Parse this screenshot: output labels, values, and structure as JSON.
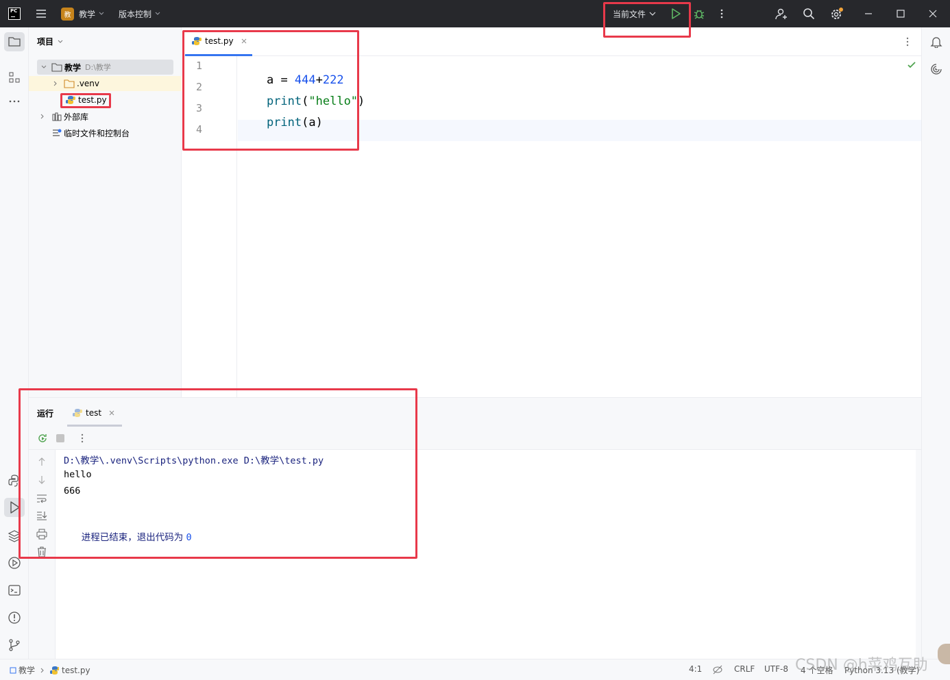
{
  "titlebar": {
    "app_logo": "PC",
    "project_badge": "教",
    "project_name": "教学",
    "vcs_label": "版本控制",
    "run_config": "当前文件"
  },
  "project_panel": {
    "title": "项目",
    "root_name": "教学",
    "root_path": "D:\\教学",
    "items": [
      {
        "label": ".venv"
      },
      {
        "label": "test.py"
      },
      {
        "label": "外部库"
      },
      {
        "label": "临时文件和控制台"
      }
    ]
  },
  "editor": {
    "tab_label": "test.py",
    "lines": [
      "1",
      "2",
      "3",
      "4"
    ],
    "code": {
      "l1_var": "a",
      "l1_op": " = ",
      "l1_n1": "444",
      "l1_plus": "+",
      "l1_n2": "222",
      "l2_fn": "print",
      "l2_open": "(",
      "l2_str": "\"hello\"",
      "l2_close": ")",
      "l3_fn": "print",
      "l3_args": "(a)"
    }
  },
  "run_panel": {
    "title": "运行",
    "tab_label": "test",
    "output": {
      "command": "D:\\教学\\.venv\\Scripts\\python.exe D:\\教学\\test.py",
      "line1": "hello",
      "line2": "666",
      "exit_text": "进程已结束，退出代码为 ",
      "exit_code": "0"
    }
  },
  "statusbar": {
    "crumb_project": "教学",
    "crumb_file": "test.py",
    "position": "4:1",
    "line_sep": "CRLF",
    "encoding": "UTF-8",
    "indent": "4 个空格",
    "interpreter": "Python 3.13 (教学)"
  },
  "watermark": "CSDN @h菜鸡互助",
  "colors": {
    "accent": "#3574f0",
    "highlight": "#e8394a",
    "run_green": "#4fa34f",
    "number_blue": "#1750eb",
    "string_green": "#067d17",
    "function_blue": "#00627a"
  }
}
